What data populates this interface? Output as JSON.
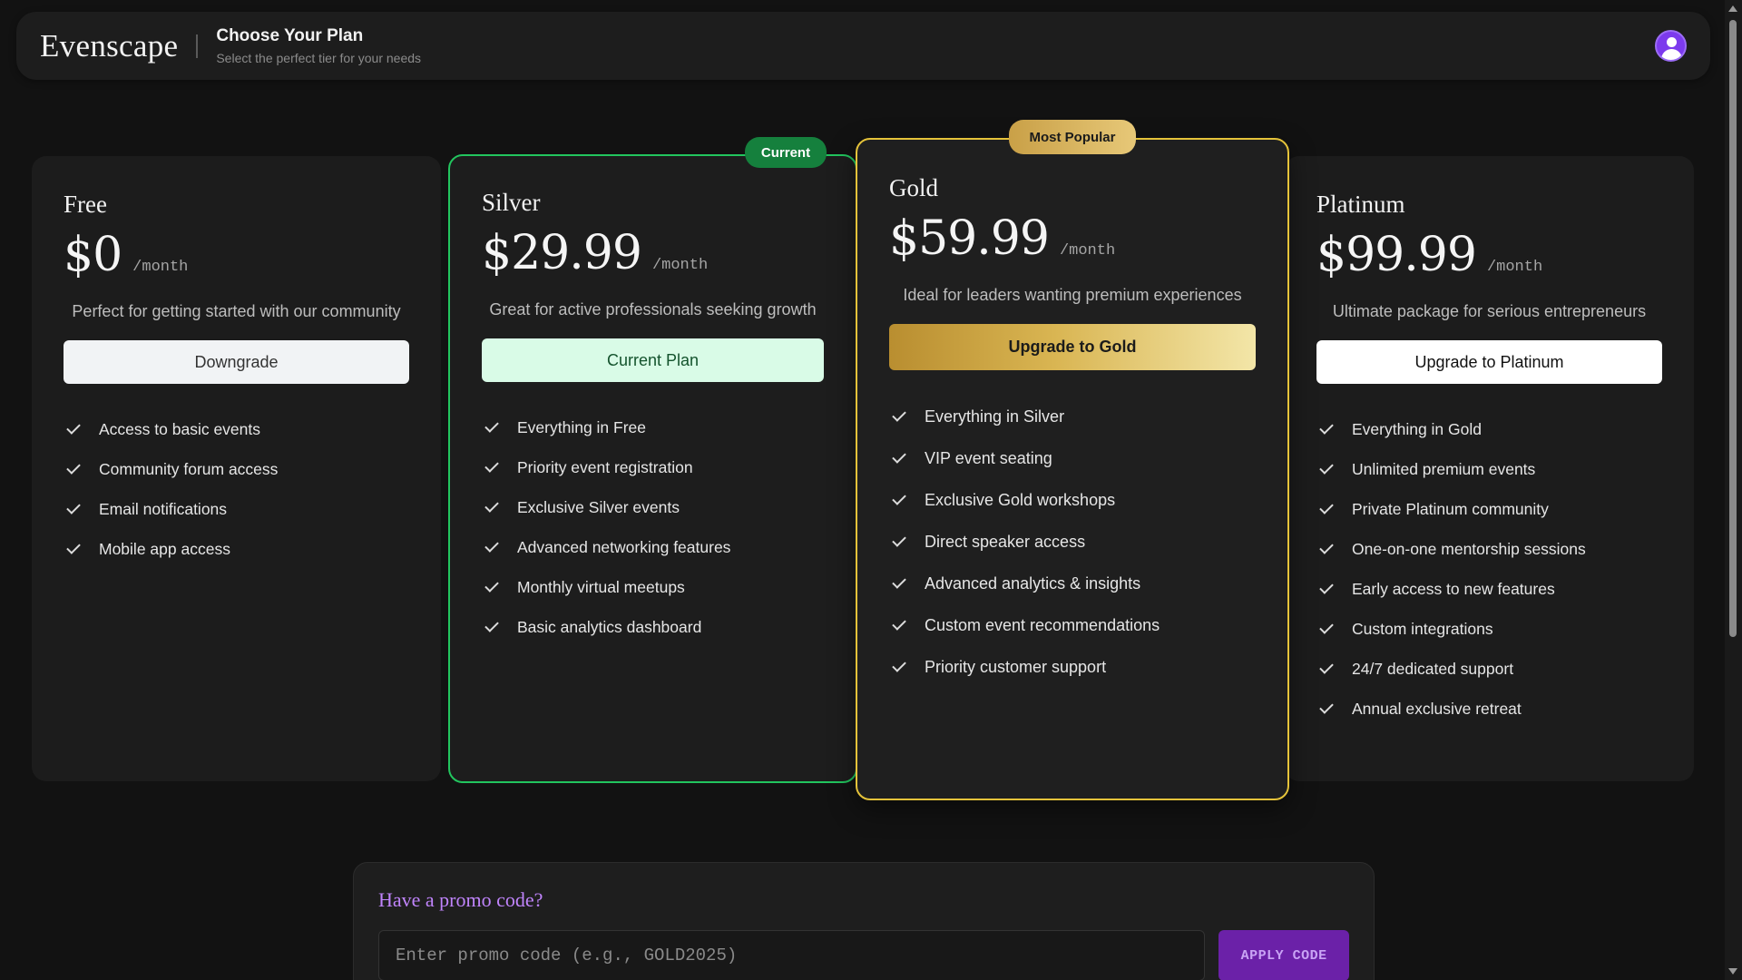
{
  "header": {
    "brand": "Evenscape",
    "title": "Choose Your Plan",
    "subtitle": "Select the perfect tier for your needs",
    "avatar_icon": "user-avatar-icon"
  },
  "badges": {
    "current": "Current",
    "popular": "Most Popular"
  },
  "plans": [
    {
      "name": "Free",
      "price": "$0",
      "period": "/month",
      "description": "Perfect for getting started with our community",
      "button": "Downgrade",
      "features": [
        "Access to basic events",
        "Community forum access",
        "Email notifications",
        "Mobile app access"
      ]
    },
    {
      "name": "Silver",
      "price": "$29.99",
      "period": "/month",
      "description": "Great for active professionals seeking growth",
      "button": "Current Plan",
      "accent": "#22c55e",
      "features": [
        "Everything in Free",
        "Priority event registration",
        "Exclusive Silver events",
        "Advanced networking features",
        "Monthly virtual meetups",
        "Basic analytics dashboard"
      ]
    },
    {
      "name": "Gold",
      "price": "$59.99",
      "period": "/month",
      "description": "Ideal for leaders wanting premium experiences",
      "button": "Upgrade to Gold",
      "accent": "#e5c33a",
      "features": [
        "Everything in Silver",
        "VIP event seating",
        "Exclusive Gold workshops",
        "Direct speaker access",
        "Advanced analytics & insights",
        "Custom event recommendations",
        "Priority customer support"
      ]
    },
    {
      "name": "Platinum",
      "price": "$99.99",
      "period": "/month",
      "description": "Ultimate package for serious entrepreneurs",
      "button": "Upgrade to Platinum",
      "features": [
        "Everything in Gold",
        "Unlimited premium events",
        "Private Platinum community",
        "One-on-one mentorship sessions",
        "Early access to new features",
        "Custom integrations",
        "24/7 dedicated support",
        "Annual exclusive retreat"
      ]
    }
  ],
  "promo": {
    "title": "Have a promo code?",
    "placeholder": "Enter promo code (e.g., GOLD2025)",
    "button": "APPLY CODE",
    "accent": "#c084fc"
  }
}
